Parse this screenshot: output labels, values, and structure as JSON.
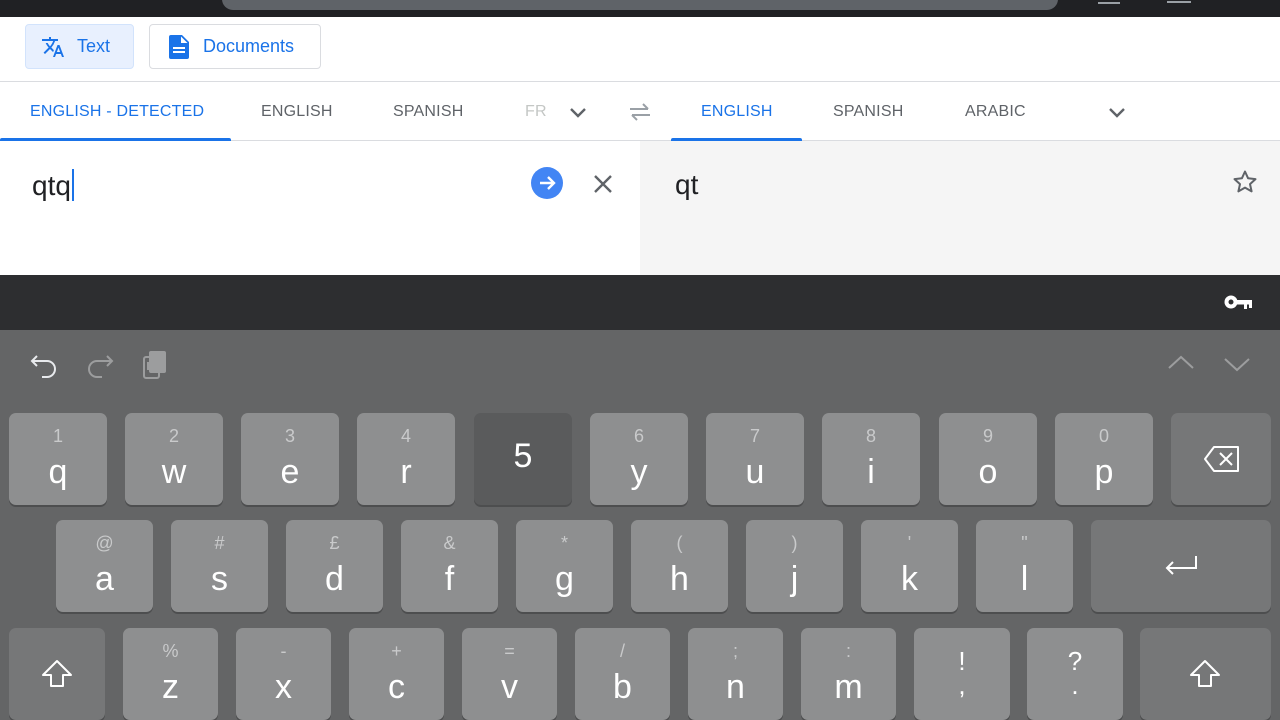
{
  "mode_bar": {
    "text_label": "Text",
    "documents_label": "Documents"
  },
  "source_langs": {
    "detected": "ENGLISH - DETECTED",
    "english": "ENGLISH",
    "spanish": "SPANISH",
    "fr": "FR"
  },
  "target_langs": {
    "english": "ENGLISH",
    "spanish": "SPANISH",
    "arabic": "ARABIC"
  },
  "source": {
    "text": "qtq"
  },
  "target": {
    "text": "qt"
  },
  "keyboard": {
    "row1": [
      {
        "hint": "1",
        "main": "q"
      },
      {
        "hint": "2",
        "main": "w"
      },
      {
        "hint": "3",
        "main": "e"
      },
      {
        "hint": "4",
        "main": "r"
      },
      {
        "hint": "",
        "main": "5"
      },
      {
        "hint": "6",
        "main": "y"
      },
      {
        "hint": "7",
        "main": "u"
      },
      {
        "hint": "8",
        "main": "i"
      },
      {
        "hint": "9",
        "main": "o"
      },
      {
        "hint": "0",
        "main": "p"
      }
    ],
    "row2": [
      {
        "hint": "@",
        "main": "a"
      },
      {
        "hint": "#",
        "main": "s"
      },
      {
        "hint": "£",
        "main": "d"
      },
      {
        "hint": "&",
        "main": "f"
      },
      {
        "hint": "*",
        "main": "g"
      },
      {
        "hint": "(",
        "main": "h"
      },
      {
        "hint": ")",
        "main": "j"
      },
      {
        "hint": "'",
        "main": "k"
      },
      {
        "hint": "\"",
        "main": "l"
      }
    ],
    "row3": [
      {
        "hint": "%",
        "main": "z"
      },
      {
        "hint": "-",
        "main": "x"
      },
      {
        "hint": "+",
        "main": "c"
      },
      {
        "hint": "=",
        "main": "v"
      },
      {
        "hint": "/",
        "main": "b"
      },
      {
        "hint": ";",
        "main": "n"
      },
      {
        "hint": ":",
        "main": "m"
      }
    ],
    "punct1": {
      "top": "!",
      "bottom": ","
    },
    "punct2": {
      "top": "?",
      "bottom": "."
    }
  },
  "colors": {
    "accent": "#1a73e8",
    "keyboard_bg": "#646566",
    "key_bg": "#8e8f90"
  }
}
